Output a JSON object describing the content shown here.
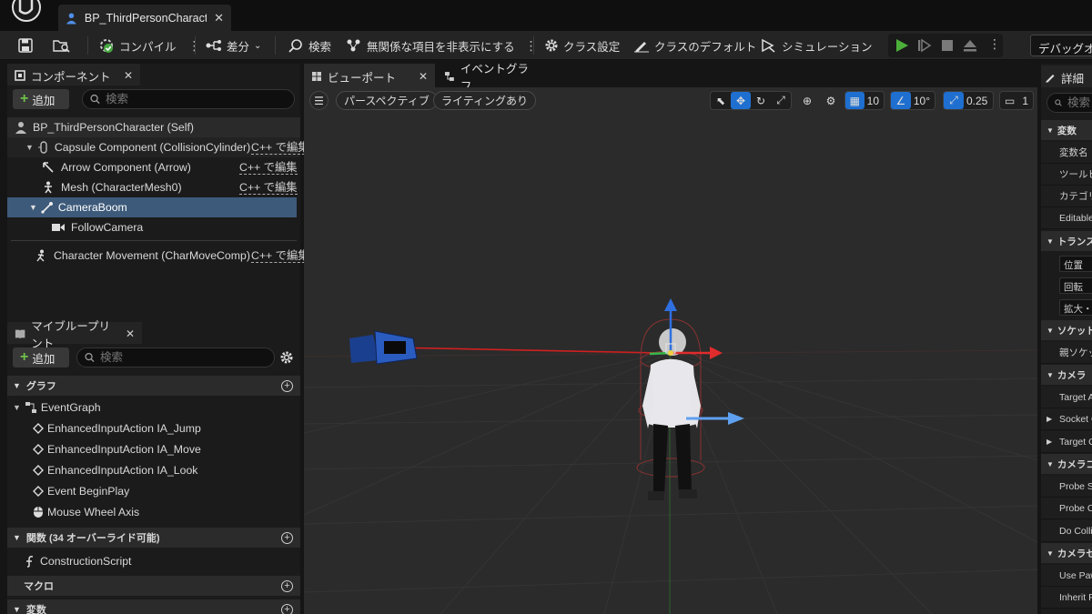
{
  "app": {
    "document_tab": "BP_ThirdPersonCharact..."
  },
  "toolbar": {
    "compile": "コンパイル",
    "diff": "差分",
    "search": "検索",
    "hide_unrelated": "無関係な項目を非表示にする",
    "class_settings": "クラス設定",
    "class_defaults": "クラスのデフォルト",
    "simulation": "シミュレーション",
    "debug_object": "デバッグオブ"
  },
  "components": {
    "tab_label": "コンポーネント",
    "add_label": "追加",
    "search_placeholder": "検索",
    "items": [
      {
        "label": "BP_ThirdPersonCharacter (Self)",
        "edit": ""
      },
      {
        "label": "Capsule Component (CollisionCylinder)",
        "edit": "C++ で編集"
      },
      {
        "label": "Arrow Component (Arrow)",
        "edit": "C++ で編集"
      },
      {
        "label": "Mesh (CharacterMesh0)",
        "edit": "C++ で編集"
      },
      {
        "label": "CameraBoom",
        "edit": ""
      },
      {
        "label": "FollowCamera",
        "edit": ""
      },
      {
        "label": "Character Movement (CharMoveComp)",
        "edit": "C++ で編集"
      }
    ]
  },
  "my_blueprint": {
    "tab_label": "マイブループリント",
    "add_label": "追加",
    "search_placeholder": "検索",
    "sections": {
      "graphs": "グラフ",
      "functions": "関数 (34 オーバーライド可能)",
      "macros": "マクロ",
      "variables": "変数"
    },
    "graph_root": "EventGraph",
    "graph_items": [
      "EnhancedInputAction IA_Jump",
      "EnhancedInputAction IA_Move",
      "EnhancedInputAction IA_Look",
      "Event BeginPlay",
      "Mouse Wheel Axis"
    ],
    "function_items": [
      "ConstructionScript"
    ]
  },
  "viewport": {
    "tab_viewport": "ビューポート",
    "tab_event_graph": "イベントグラフ",
    "perspective": "パースペクティブ",
    "lighting": "ライティングあり",
    "grid_snap": "10",
    "rotation_snap": "10°",
    "scale_snap": "0.25",
    "camera_speed": "1"
  },
  "details": {
    "tab_label": "詳細",
    "search_placeholder": "検索",
    "sections": [
      "変数",
      "トランスフォーム",
      "ソケット",
      "カメラ",
      "カメラコリジョン",
      "カメラセッティングス"
    ],
    "rows": {
      "var_name": "変数名",
      "tooltip": "ツールヒント",
      "category": "カテゴリ",
      "editable": "Editable",
      "location": "位置",
      "rotation": "回転",
      "scale": "拡大・縮小",
      "parent_socket": "親ソケット",
      "target_arm": "Target Arm Length",
      "socket_offset": "Socket Offset",
      "target_offset": "Target Offset",
      "probe_size": "Probe Size",
      "probe_channel": "Probe Channel",
      "do_collision": "Do Collision Test",
      "use_pawn": "Use Pawn Control Rotation",
      "inherit_pitch": "Inherit Pitch"
    }
  },
  "colors": {
    "accent_blue": "#1e6fd0",
    "selection": "#3d5a7a",
    "add_green": "#6fc04a",
    "play_green": "#4caf3a"
  }
}
